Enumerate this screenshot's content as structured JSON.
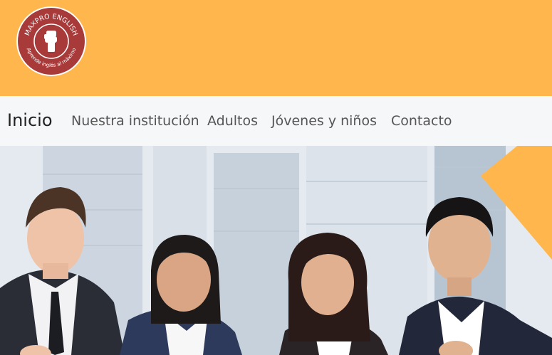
{
  "brand": {
    "logo_top_text": "MAXPRO ENGLISH",
    "logo_bottom_text": "Aprende inglés al máximo",
    "colors": {
      "header_bg": "#FFB74D",
      "logo_red": "#A83A3A",
      "nav_bg": "#F6F7F9",
      "accent_orange": "#FFB74D"
    }
  },
  "nav": {
    "brand_label": "Inicio",
    "items": [
      {
        "label": "Nuestra institución"
      },
      {
        "label": "Adultos"
      },
      {
        "label": "Jóvenes y niños"
      },
      {
        "label": "Contacto"
      }
    ]
  },
  "hero": {
    "image_icon": "people-photo-icon"
  }
}
